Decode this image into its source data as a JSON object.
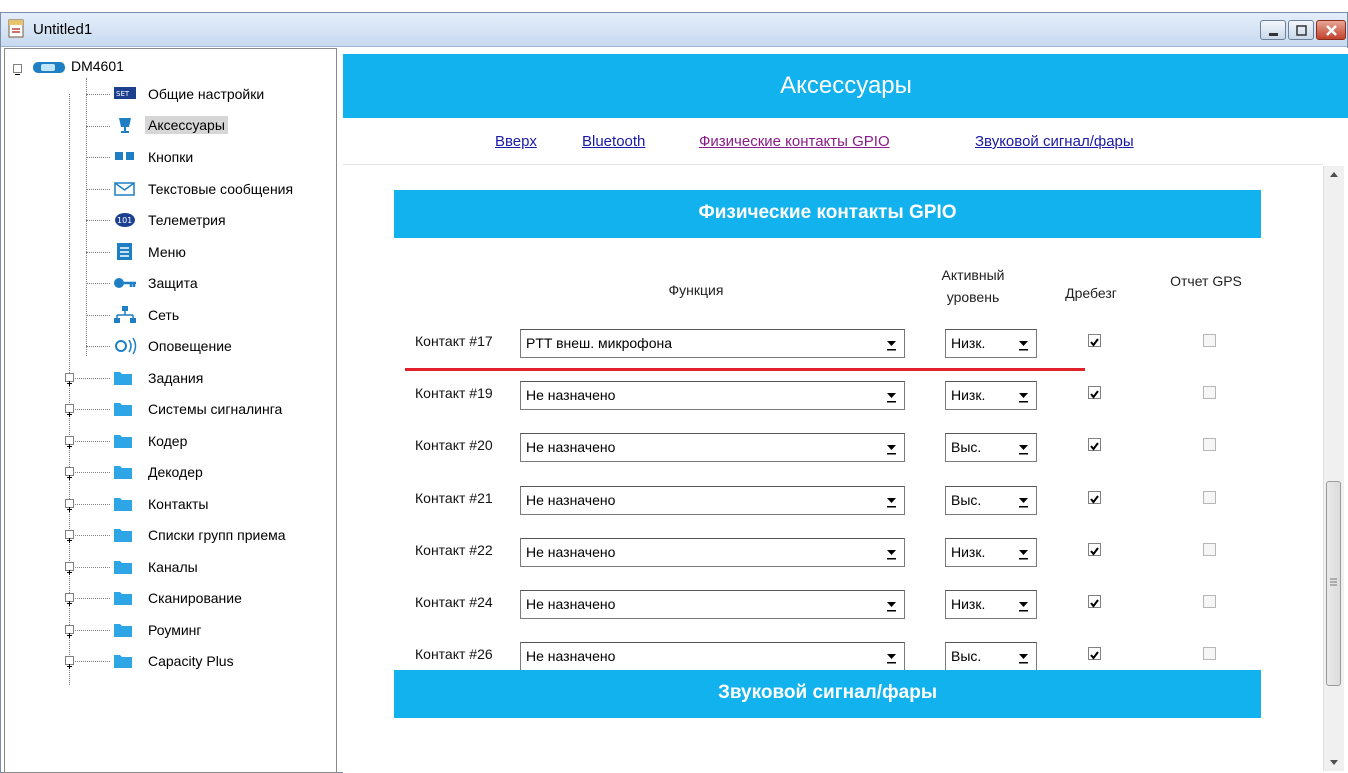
{
  "window": {
    "title": "Untitled1"
  },
  "tree": {
    "root": "DM4601",
    "items": [
      {
        "label": "Общие настройки",
        "icon": "settings-icon"
      },
      {
        "label": "Аксессуары",
        "icon": "microphone-icon",
        "selected": true
      },
      {
        "label": "Кнопки",
        "icon": "buttons-icon"
      },
      {
        "label": "Текстовые сообщения",
        "icon": "envelope-icon"
      },
      {
        "label": "Телеметрия",
        "icon": "telemetry-icon"
      },
      {
        "label": "Меню",
        "icon": "menu-icon"
      },
      {
        "label": "Защита",
        "icon": "key-icon"
      },
      {
        "label": "Сеть",
        "icon": "network-icon"
      },
      {
        "label": "Оповещение",
        "icon": "alert-icon"
      }
    ],
    "folders": [
      "Задания",
      "Системы сигналинга",
      "Кодер",
      "Декодер",
      "Контакты",
      "Списки групп приема",
      "Каналы",
      "Сканирование",
      "Роуминг",
      "Capacity Plus"
    ]
  },
  "page": {
    "title": "Аксессуары",
    "nav": [
      "Вверх",
      "Bluetooth",
      "Физические контакты GPIO",
      "Звуковой сигнал/фары"
    ],
    "section_gpio": "Физические контакты GPIO",
    "section_sound": "Звуковой сигнал/фары",
    "columns": {
      "function": "Функция",
      "active_line1": "Активный",
      "active_line2": "уровень",
      "debounce": "Дребезг",
      "gps": "Отчет GPS"
    },
    "rows": [
      {
        "label": "Контакт #17",
        "function": "PTT внеш. микрофона",
        "level": "Низк.",
        "debounce": true,
        "gps": false
      },
      {
        "label": "Контакт #19",
        "function": "Не назначено",
        "level": "Низк.",
        "debounce": true,
        "gps": false
      },
      {
        "label": "Контакт #20",
        "function": "Не назначено",
        "level": "Выс.",
        "debounce": true,
        "gps": false
      },
      {
        "label": "Контакт #21",
        "function": "Не назначено",
        "level": "Выс.",
        "debounce": true,
        "gps": false
      },
      {
        "label": "Контакт #22",
        "function": "Не назначено",
        "level": "Низк.",
        "debounce": true,
        "gps": false
      },
      {
        "label": "Контакт #24",
        "function": "Не назначено",
        "level": "Низк.",
        "debounce": true,
        "gps": false
      },
      {
        "label": "Контакт #26",
        "function": "Не назначено",
        "level": "Выс.",
        "debounce": true,
        "gps": false
      }
    ]
  },
  "colors": {
    "accent": "#12b2ee",
    "highlight_line": "#e0202a"
  }
}
